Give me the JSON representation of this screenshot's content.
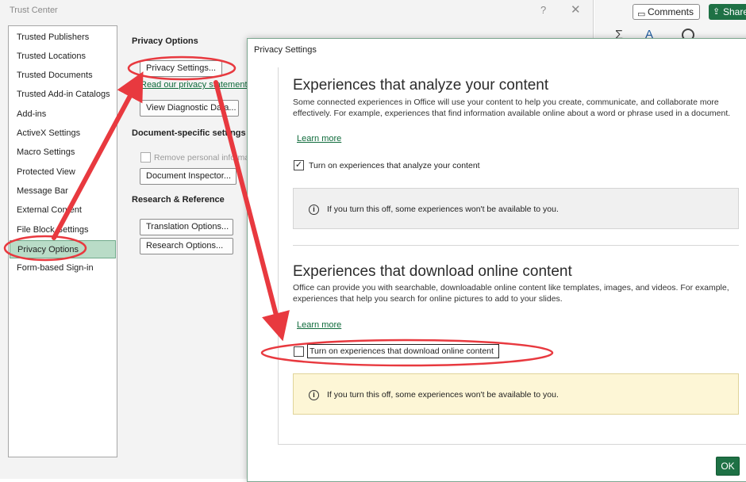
{
  "trust_center": {
    "title": "Trust Center",
    "help_icon": "question-mark-icon",
    "close_icon": "close-icon",
    "nav_items": [
      "Trusted Publishers",
      "Trusted Locations",
      "Trusted Documents",
      "Trusted Add-in Catalogs",
      "Add-ins",
      "ActiveX Settings",
      "Macro Settings",
      "Protected View",
      "Message Bar",
      "External Content",
      "File Block Settings",
      "Privacy Options",
      "Form-based Sign-in"
    ],
    "selected_nav": "Privacy Options",
    "content": {
      "privacy_options_heading": "Privacy Options",
      "privacy_settings_button": "Privacy Settings...",
      "read_privacy_link": "Read our privacy statement",
      "view_diagnostic_button": "View Diagnostic Data...",
      "document_specific_heading": "Document-specific settings",
      "remove_personal_label": "Remove personal information",
      "document_inspector_button": "Document Inspector...",
      "research_reference_heading": "Research & Reference",
      "translation_options_button": "Translation Options...",
      "research_options_button": "Research Options..."
    }
  },
  "excel_ribbon": {
    "comments_button": "Comments",
    "share_button": "Share"
  },
  "privacy_settings": {
    "title": "Privacy Settings",
    "analyze": {
      "heading": "Experiences that analyze your content",
      "description": "Some connected experiences in Office will use your content to help you create, communicate, and collaborate more effectively. For example, experiences that find information available online about a word or phrase used in a document.",
      "learn_more": "Learn more",
      "checkbox_label": "Turn on experiences that analyze your content",
      "checked": true,
      "info_text": "If you turn this off, some experiences won't be available to you."
    },
    "download": {
      "heading": "Experiences that download online content",
      "description": "Office can provide you with searchable, downloadable online content like templates, images, and videos. For example, experiences that help you search for online pictures to add to your slides.",
      "learn_more": "Learn more",
      "checkbox_label": "Turn on experiences that download online content",
      "checked": false,
      "info_text": "If you turn this off, some experiences won't be available to you."
    },
    "ok_button": "OK"
  },
  "colors": {
    "accent_green": "#1e7145",
    "selection_green": "#b9dcc7",
    "annotation_red": "#e8393f",
    "warning_bg": "#fdf6d6"
  }
}
